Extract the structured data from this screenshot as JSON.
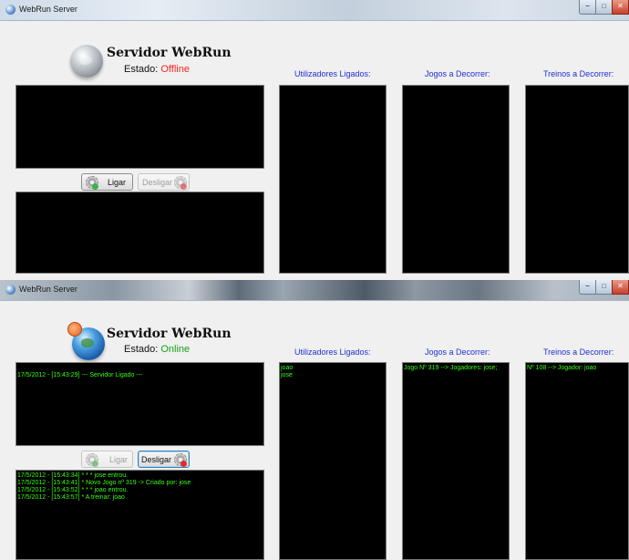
{
  "windows": [
    {
      "title": "WebRun Server",
      "header": {
        "title": "Servidor WebRun",
        "status_label": "Estado:",
        "status_value": "Offline",
        "status_color": "#ff2020"
      },
      "columns": {
        "users": "Utilizadores Ligados:",
        "games": "Jogos a Decorrer:",
        "trainings": "Treinos a Decorrer:"
      },
      "buttons": {
        "connect": "Ligar",
        "disconnect": "Desligar"
      },
      "log_top": [],
      "log_bottom": [],
      "users": [],
      "games": [],
      "trainings": []
    },
    {
      "title": "WebRun Server",
      "header": {
        "title": "Servidor WebRun",
        "status_label": "Estado:",
        "status_value": "Online",
        "status_color": "#18a018"
      },
      "columns": {
        "users": "Utilizadores Ligados:",
        "games": "Jogos a Decorrer:",
        "trainings": "Treinos a Decorrer:"
      },
      "buttons": {
        "connect": "Ligar",
        "disconnect": "Desligar"
      },
      "log_top": [
        "17/5/2012 - [15:43:29] --- Servidor Ligado ---"
      ],
      "log_bottom": [
        "17/5/2012 - [15:43:34] * * * jose entrou.",
        "17/5/2012 - [15:43:41] * Novo Jogo nº 319 -> Criado por: jose",
        "17/5/2012 - [15:43:52] * * * joao entrou.",
        "17/5/2012 - [15:43:57] * A treinar: joao"
      ],
      "users": [
        "joao",
        "jose"
      ],
      "games": [
        "Jogo Nº 319 --> Jogadores: jose;"
      ],
      "trainings": [
        "Nº 108 --> Jogador: joao"
      ]
    }
  ],
  "colors": {
    "header_blue": "#1f2fd6",
    "console_text": "#39ff14",
    "console_bg": "#000000"
  },
  "icons": {
    "app": "globe-icon",
    "connect": "gear-check-icon",
    "disconnect": "gear-x-icon",
    "minimize": "minimize-icon",
    "maximize": "maximize-icon",
    "close": "close-icon"
  },
  "window_controls": {
    "minimize": "–",
    "maximize": "□",
    "close": "✕"
  }
}
